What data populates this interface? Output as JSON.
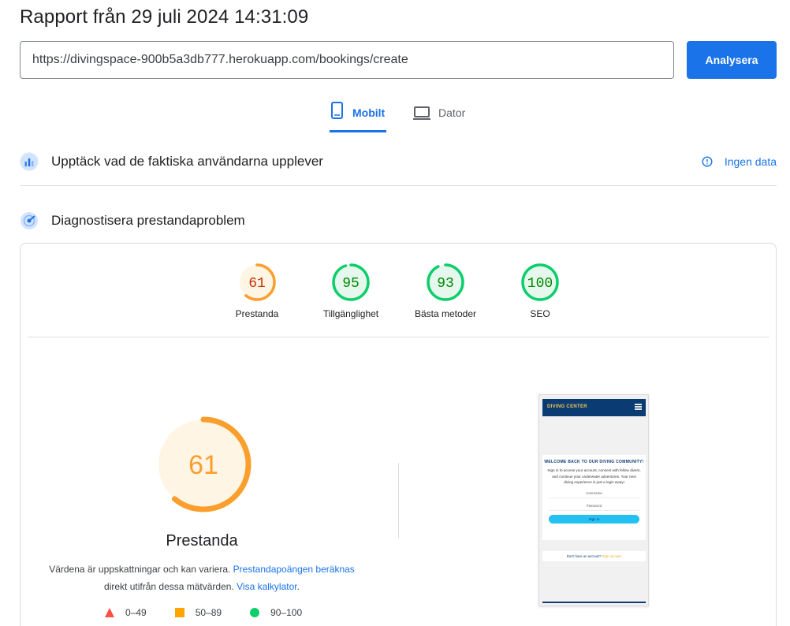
{
  "report": {
    "title": "Rapport från 29 juli 2024 14:31:09"
  },
  "search": {
    "url": "https://divingspace-900b5a3db777.herokuapp.com/bookings/create",
    "analyze_label": "Analysera"
  },
  "tabs": [
    {
      "label": "Mobilt",
      "icon": "smartphone-icon",
      "active": true
    },
    {
      "label": "Dator",
      "icon": "laptop-icon",
      "active": false
    }
  ],
  "crux": {
    "label": "Upptäck vad de faktiska användarna upplever",
    "no_data": "Ingen data",
    "icon": "users-chart-icon"
  },
  "diagnose": {
    "label": "Diagnostisera prestandaproblem",
    "icon": "lighthouse-icon"
  },
  "scores": [
    {
      "value": 61,
      "label": "Prestanda",
      "color": "#fa9f2d",
      "bg": "#fff5e5"
    },
    {
      "value": 95,
      "label": "Tillgänglighet",
      "color": "#0cce6b",
      "bg": "#e6f8ee"
    },
    {
      "value": 93,
      "label": "Bästa metoder",
      "color": "#0cce6b",
      "bg": "#e6f8ee"
    },
    {
      "value": 100,
      "label": "SEO",
      "color": "#0cce6b",
      "bg": "#e6f8ee"
    }
  ],
  "performance": {
    "score": 61,
    "title": "Prestanda",
    "desc_text1": "Värdena är uppskattningar och kan variera. ",
    "desc_link1": "Prestandapoängen beräknas",
    "desc_text2": "direkt utifrån dessa mätvärden. ",
    "desc_link2": "Visa kalkylator",
    "desc_text3": "."
  },
  "legend": [
    {
      "range": "0–49",
      "shape": "triangle",
      "color": "#ff4e42"
    },
    {
      "range": "50–89",
      "shape": "square",
      "color": "#ffa400"
    },
    {
      "range": "90–100",
      "shape": "circle",
      "color": "#0cce6b"
    }
  ],
  "screenshot": {
    "brand": "DIVING CENTER",
    "heading": "WELCOME BACK TO OUR DIVING COMMUNITY!",
    "intro": "Sign in to access your account, connect with fellow divers, and continue your underwater adventures. Your next diving experience is just a login away!",
    "username_label": "Username",
    "password_label": "Password",
    "signin_label": "Sign in",
    "footer_text": "Don't have an account? ",
    "footer_link": "Sign up now!"
  }
}
